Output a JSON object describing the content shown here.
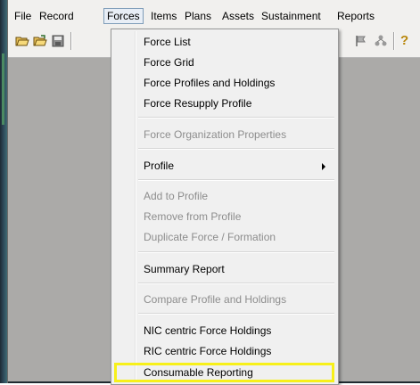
{
  "menubar": {
    "items": [
      "File",
      "Record",
      "Forces",
      "Items",
      "Plans",
      "Assets",
      "Sustainment",
      "Reports"
    ],
    "active": "Forces"
  },
  "toolbar": {
    "icons": [
      "open-folder-icon",
      "open-folder-alt-icon",
      "save-icon",
      "flag-icon",
      "tree-icon",
      "help-icon"
    ]
  },
  "dropdown": {
    "items": [
      {
        "label": "Force List",
        "enabled": true
      },
      {
        "label": "Force Grid",
        "enabled": true
      },
      {
        "label": "Force Profiles and Holdings",
        "enabled": true
      },
      {
        "label": "Force Resupply Profile",
        "enabled": true
      },
      {
        "label": "Force Organization Properties",
        "enabled": false
      },
      {
        "label": "Profile",
        "enabled": true,
        "submenu": true
      },
      {
        "label": "Add to Profile",
        "enabled": false
      },
      {
        "label": "Remove from Profile",
        "enabled": false
      },
      {
        "label": "Duplicate Force / Formation",
        "enabled": false
      },
      {
        "label": "Summary Report",
        "enabled": true
      },
      {
        "label": "Compare Profile and Holdings",
        "enabled": false
      },
      {
        "label": "NIC centric Force Holdings",
        "enabled": true
      },
      {
        "label": "RIC centric Force Holdings",
        "enabled": true
      },
      {
        "label": "Consumable Reporting",
        "enabled": true,
        "highlighted": true
      }
    ]
  },
  "colors": {
    "highlight": "#f7f01a",
    "workspace": "#abaaa8",
    "menu_bg": "#f0f0f0",
    "disabled_text": "#8d8d8d"
  }
}
